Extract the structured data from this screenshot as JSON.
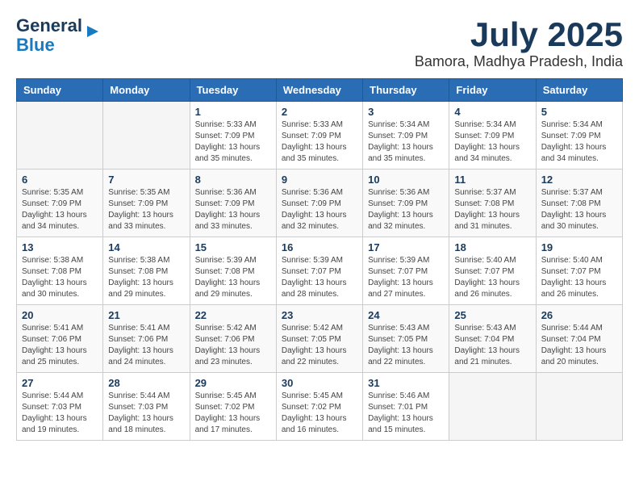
{
  "header": {
    "logo_line1": "General",
    "logo_line2": "Blue",
    "month_year": "July 2025",
    "location": "Bamora, Madhya Pradesh, India"
  },
  "weekdays": [
    "Sunday",
    "Monday",
    "Tuesday",
    "Wednesday",
    "Thursday",
    "Friday",
    "Saturday"
  ],
  "weeks": [
    [
      {
        "day": "",
        "info": ""
      },
      {
        "day": "",
        "info": ""
      },
      {
        "day": "1",
        "info": "Sunrise: 5:33 AM\nSunset: 7:09 PM\nDaylight: 13 hours\nand 35 minutes."
      },
      {
        "day": "2",
        "info": "Sunrise: 5:33 AM\nSunset: 7:09 PM\nDaylight: 13 hours\nand 35 minutes."
      },
      {
        "day": "3",
        "info": "Sunrise: 5:34 AM\nSunset: 7:09 PM\nDaylight: 13 hours\nand 35 minutes."
      },
      {
        "day": "4",
        "info": "Sunrise: 5:34 AM\nSunset: 7:09 PM\nDaylight: 13 hours\nand 34 minutes."
      },
      {
        "day": "5",
        "info": "Sunrise: 5:34 AM\nSunset: 7:09 PM\nDaylight: 13 hours\nand 34 minutes."
      }
    ],
    [
      {
        "day": "6",
        "info": "Sunrise: 5:35 AM\nSunset: 7:09 PM\nDaylight: 13 hours\nand 34 minutes."
      },
      {
        "day": "7",
        "info": "Sunrise: 5:35 AM\nSunset: 7:09 PM\nDaylight: 13 hours\nand 33 minutes."
      },
      {
        "day": "8",
        "info": "Sunrise: 5:36 AM\nSunset: 7:09 PM\nDaylight: 13 hours\nand 33 minutes."
      },
      {
        "day": "9",
        "info": "Sunrise: 5:36 AM\nSunset: 7:09 PM\nDaylight: 13 hours\nand 32 minutes."
      },
      {
        "day": "10",
        "info": "Sunrise: 5:36 AM\nSunset: 7:09 PM\nDaylight: 13 hours\nand 32 minutes."
      },
      {
        "day": "11",
        "info": "Sunrise: 5:37 AM\nSunset: 7:08 PM\nDaylight: 13 hours\nand 31 minutes."
      },
      {
        "day": "12",
        "info": "Sunrise: 5:37 AM\nSunset: 7:08 PM\nDaylight: 13 hours\nand 30 minutes."
      }
    ],
    [
      {
        "day": "13",
        "info": "Sunrise: 5:38 AM\nSunset: 7:08 PM\nDaylight: 13 hours\nand 30 minutes."
      },
      {
        "day": "14",
        "info": "Sunrise: 5:38 AM\nSunset: 7:08 PM\nDaylight: 13 hours\nand 29 minutes."
      },
      {
        "day": "15",
        "info": "Sunrise: 5:39 AM\nSunset: 7:08 PM\nDaylight: 13 hours\nand 29 minutes."
      },
      {
        "day": "16",
        "info": "Sunrise: 5:39 AM\nSunset: 7:07 PM\nDaylight: 13 hours\nand 28 minutes."
      },
      {
        "day": "17",
        "info": "Sunrise: 5:39 AM\nSunset: 7:07 PM\nDaylight: 13 hours\nand 27 minutes."
      },
      {
        "day": "18",
        "info": "Sunrise: 5:40 AM\nSunset: 7:07 PM\nDaylight: 13 hours\nand 26 minutes."
      },
      {
        "day": "19",
        "info": "Sunrise: 5:40 AM\nSunset: 7:07 PM\nDaylight: 13 hours\nand 26 minutes."
      }
    ],
    [
      {
        "day": "20",
        "info": "Sunrise: 5:41 AM\nSunset: 7:06 PM\nDaylight: 13 hours\nand 25 minutes."
      },
      {
        "day": "21",
        "info": "Sunrise: 5:41 AM\nSunset: 7:06 PM\nDaylight: 13 hours\nand 24 minutes."
      },
      {
        "day": "22",
        "info": "Sunrise: 5:42 AM\nSunset: 7:06 PM\nDaylight: 13 hours\nand 23 minutes."
      },
      {
        "day": "23",
        "info": "Sunrise: 5:42 AM\nSunset: 7:05 PM\nDaylight: 13 hours\nand 22 minutes."
      },
      {
        "day": "24",
        "info": "Sunrise: 5:43 AM\nSunset: 7:05 PM\nDaylight: 13 hours\nand 22 minutes."
      },
      {
        "day": "25",
        "info": "Sunrise: 5:43 AM\nSunset: 7:04 PM\nDaylight: 13 hours\nand 21 minutes."
      },
      {
        "day": "26",
        "info": "Sunrise: 5:44 AM\nSunset: 7:04 PM\nDaylight: 13 hours\nand 20 minutes."
      }
    ],
    [
      {
        "day": "27",
        "info": "Sunrise: 5:44 AM\nSunset: 7:03 PM\nDaylight: 13 hours\nand 19 minutes."
      },
      {
        "day": "28",
        "info": "Sunrise: 5:44 AM\nSunset: 7:03 PM\nDaylight: 13 hours\nand 18 minutes."
      },
      {
        "day": "29",
        "info": "Sunrise: 5:45 AM\nSunset: 7:02 PM\nDaylight: 13 hours\nand 17 minutes."
      },
      {
        "day": "30",
        "info": "Sunrise: 5:45 AM\nSunset: 7:02 PM\nDaylight: 13 hours\nand 16 minutes."
      },
      {
        "day": "31",
        "info": "Sunrise: 5:46 AM\nSunset: 7:01 PM\nDaylight: 13 hours\nand 15 minutes."
      },
      {
        "day": "",
        "info": ""
      },
      {
        "day": "",
        "info": ""
      }
    ]
  ]
}
